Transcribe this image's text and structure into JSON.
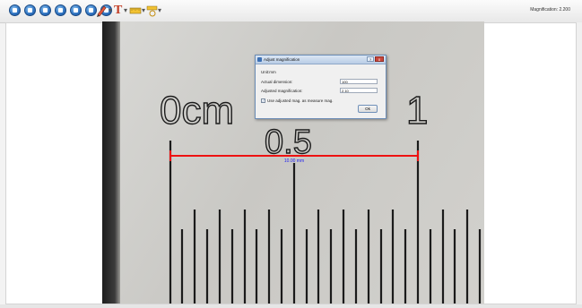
{
  "toolbar": {
    "buttons": [
      "new-icon",
      "open-icon",
      "save-icon",
      "capture-icon",
      "record-icon",
      "settings-icon",
      "help-icon"
    ],
    "pen_tool": "pen-icon",
    "text_tool": "T",
    "magnification_label": "Magnification: 2.200"
  },
  "image": {
    "scale_left_label": "0cm",
    "scale_mid_label": "0.5",
    "scale_right_label": "1",
    "measurement_label": "10.00 mm",
    "colors": {
      "measure_line": "#ee1111",
      "measure_text": "#2222ee"
    }
  },
  "dialog": {
    "title": "Adjust magnification",
    "unit": "Unit:mm",
    "actual_dimension_label": "Actual dimension:",
    "actual_dimension_value": "100",
    "adjusted_magnification_label": "Adjusted magnification:",
    "adjusted_magnification_value": "2.10",
    "checkbox_label": "Use adjusted mag. as measure mag.",
    "checkbox_checked": true,
    "ok_label": "Ok",
    "help_label": "?",
    "close_label": "x"
  }
}
